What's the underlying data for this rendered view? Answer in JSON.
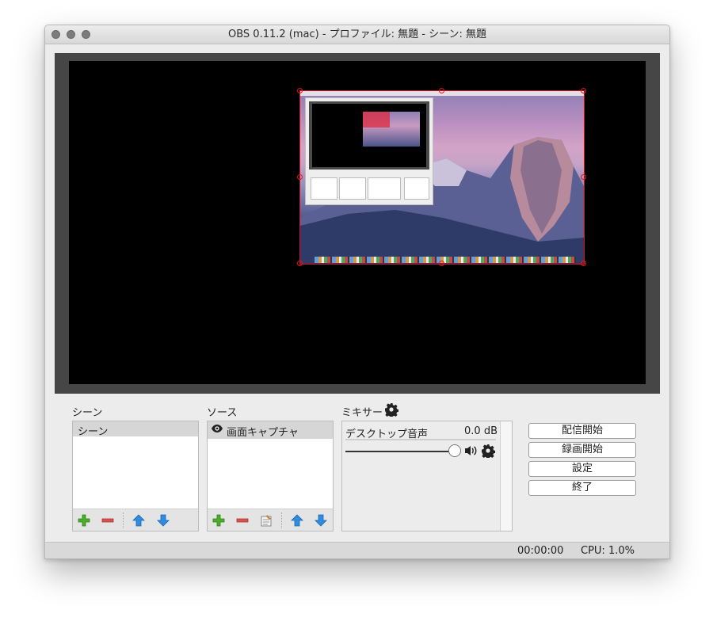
{
  "window": {
    "title": "OBS 0.11.2 (mac) - プロファイル: 無題 - シーン: 無題"
  },
  "scenes": {
    "label": "シーン",
    "items": [
      "シーン"
    ]
  },
  "sources": {
    "label": "ソース",
    "items": [
      "画面キャプチャ"
    ]
  },
  "mixer": {
    "label": "ミキサー",
    "channel": {
      "name": "デスクトップ音声",
      "level": "0.0 dB",
      "volume_fraction": 1.0
    }
  },
  "controls": {
    "start_streaming": "配信開始",
    "start_recording": "録画開始",
    "settings": "設定",
    "exit": "終了"
  },
  "status": {
    "time": "00:00:00",
    "cpu": "CPU: 1.0%"
  },
  "colors": {
    "add": "#4caf2a",
    "remove": "#d9534f",
    "arrows": "#2f8de0",
    "selection": "#dd1111"
  },
  "icons": {
    "add": "plus-icon",
    "remove": "minus-icon",
    "up": "arrow-up-icon",
    "down": "arrow-down-icon",
    "properties": "properties-icon",
    "visibility": "eye-icon",
    "gear": "gear-icon",
    "speaker": "speaker-icon"
  }
}
